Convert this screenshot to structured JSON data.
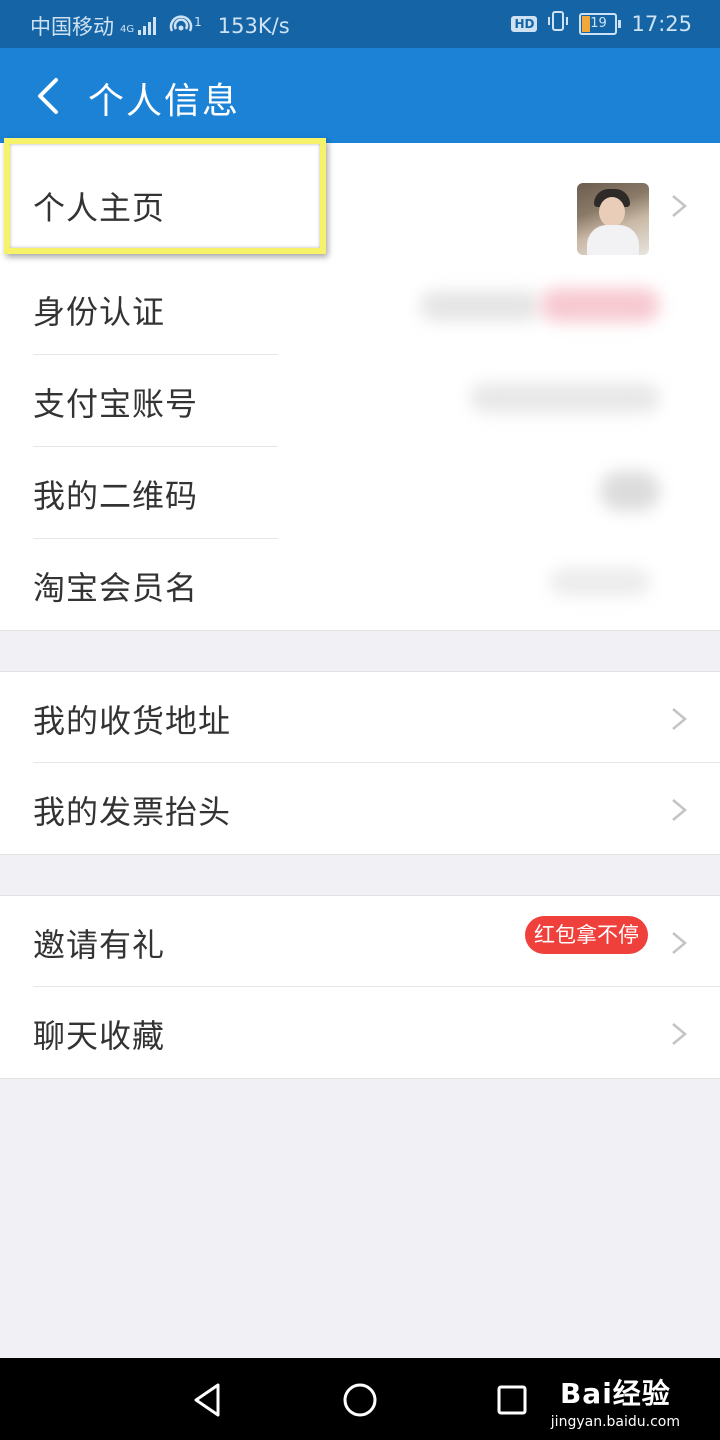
{
  "status_bar": {
    "carrier": "中国移动",
    "network_tag": "4G",
    "wifi_tag": "1",
    "speed": "153K/s",
    "hd": "HD",
    "battery_level": "19",
    "time": "17:25"
  },
  "header": {
    "title": "个人信息",
    "back_icon": "chevron-left-icon"
  },
  "group1": {
    "items": [
      {
        "label": "个人主页"
      },
      {
        "label": "身份认证"
      },
      {
        "label": "支付宝账号"
      },
      {
        "label": "我的二维码"
      },
      {
        "label": "淘宝会员名"
      }
    ]
  },
  "group2": {
    "items": [
      {
        "label": "我的收货地址"
      },
      {
        "label": "我的发票抬头"
      }
    ]
  },
  "group3": {
    "items": [
      {
        "label": "邀请有礼",
        "badge": "红包拿不停"
      },
      {
        "label": "聊天收藏"
      }
    ]
  },
  "bottom_nav": {
    "brand": "Bai经验",
    "brand_url": "jingyan.baidu.com"
  },
  "colors": {
    "status_bar": "#1565a6",
    "nav_bar": "#1b82d6",
    "highlight": "#f6f36a",
    "badge": "#f0403c",
    "background": "#f1f1f5"
  }
}
